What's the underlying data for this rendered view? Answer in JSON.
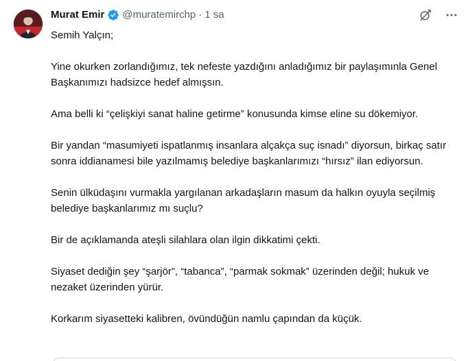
{
  "tweet": {
    "author": {
      "name": "Murat Emir",
      "handle": "@muratemirchp",
      "separator": "·",
      "time": "1 sa",
      "verified": true,
      "verified_color": "#1d9bf0"
    },
    "icons": {
      "grok": "grok-icon",
      "more": "more-options-icon",
      "verified": "verified-badge-icon"
    },
    "paragraphs": [
      "Semih Yalçın;",
      "Yine okurken zorlandığımız, tek nefeste yazdığını anladığımız bir paylaşımınla Genel Başkanımızı hadsizce hedef almışsın.",
      "Ama belli ki “çelişkiyi sanat haline getirme” konusunda kimse eline su dökemiyor.",
      "Bir yandan “masumiyeti ispatlanmış insanlara alçakça suç isnadı” diyorsun, birkaç satır sonra iddianamesi bile yazılmamış belediye başkanlarımızı “hırsız” ilan ediyorsun.",
      "Senin ülküdaşını vurmakla yargılanan arkadaşların masum da halkın oyuyla seçilmiş belediye başkanlarımız mı suçlu?",
      "Bir de açıklamanda ateşli silahlara olan ilgin dikkatimi çekti.",
      "Siyaset dediğin şey “şarjör”, “tabanca”, “parmak sokmak” üzerinden değil; hukuk ve nezaket üzerinden yürür.",
      "Korkarım siyasetteki kalibren, övündüğün namlu çapından da küçük."
    ]
  }
}
